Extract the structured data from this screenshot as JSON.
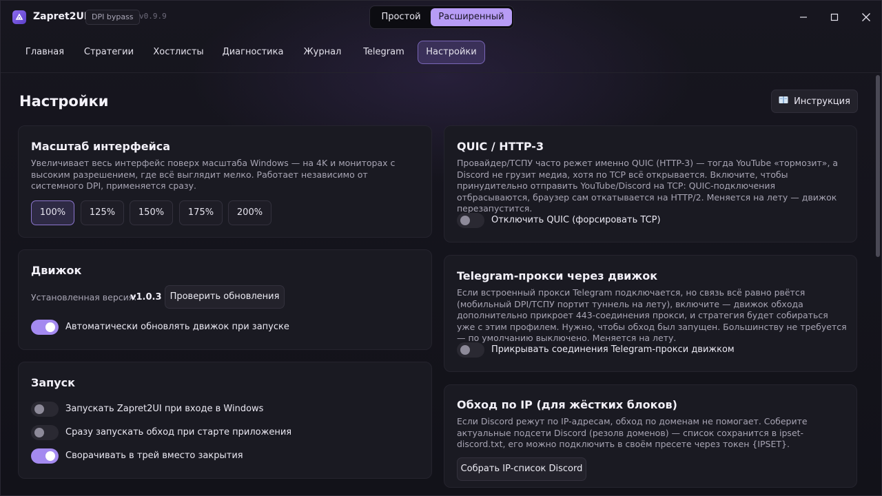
{
  "app": {
    "title": "Zapret2UI",
    "badge": "DPI bypass",
    "version": "v0.9.9"
  },
  "mode": {
    "simple": "Простой",
    "advanced": "Расширенный",
    "selected": "advanced"
  },
  "nav": {
    "items": [
      "Главная",
      "Стратегии",
      "Хостлисты",
      "Диагностика",
      "Журнал",
      "Telegram",
      "Настройки"
    ],
    "active": "Настройки"
  },
  "page": {
    "title": "Настройки",
    "help_label": "Инструкция"
  },
  "scale": {
    "title": "Масштаб интерфейса",
    "desc": "Увеличивает весь интерфейс поверх масштаба Windows — на 4K и мониторах с высоким разрешением, где всё выглядит мелко. Работает независимо от системного DPI, применяется сразу.",
    "options": [
      "100%",
      "125%",
      "150%",
      "175%",
      "200%"
    ],
    "selected": "100%"
  },
  "engine": {
    "title": "Движок",
    "version_label": "Установленная версия:",
    "version": "v1.0.3",
    "check_updates": "Проверить обновления",
    "auto_update_label": "Автоматически обновлять движок при запуске",
    "auto_update": true
  },
  "startup": {
    "title": "Запуск",
    "items": [
      {
        "label": "Запускать Zapret2UI при входе в Windows",
        "on": false
      },
      {
        "label": "Сразу запускать обход при старте приложения",
        "on": false
      },
      {
        "label": "Сворачивать в трей вместо закрытия",
        "on": true
      }
    ]
  },
  "quic": {
    "title": "QUIC / HTTP-3",
    "desc": "Провайдер/ТСПУ часто режет именно QUIC (HTTP-3) — тогда YouTube «тормозит», а Discord не грузит медиа, хотя по TCP всё открывается. Включите, чтобы принудительно отправить YouTube/Discord на TCP: QUIC-подключения отбрасываются, браузер сам откатывается на HTTP/2. Меняется на лету — движок перезапустится.",
    "toggle_label": "Отключить QUIC (форсировать TCP)",
    "on": false
  },
  "telegram_proxy": {
    "title": "Telegram-прокси через движок",
    "desc": "Если встроенный прокси Telegram подключается, но связь всё равно рвётся (мобильный DPI/ТСПУ портит туннель на лету), включите — движок обхода дополнительно прикроет 443-соединения прокси, и стратегия будет собираться уже с этим профилем. Нужно, чтобы обход был запущен. Большинству не требуется — по умолчанию выключено. Меняется на лету.",
    "toggle_label": "Прикрывать соединения Telegram-прокси движком",
    "on": false
  },
  "ip_bypass": {
    "title": "Обход по IP (для жёстких блоков)",
    "desc": "Если Discord режут по IP-адресам, обход по доменам не помогает. Соберите актуальные подсети Discord (резолв доменов) — список сохранится в ipset-discord.txt, его можно подключить в своём пресете через токен {IPSET}.",
    "button": "Собрать IP-список Discord"
  },
  "colors": {
    "accent": "#b79cf5",
    "toggle_on": "#a48af0",
    "background": "#14141c",
    "card": "#1a1a22"
  }
}
